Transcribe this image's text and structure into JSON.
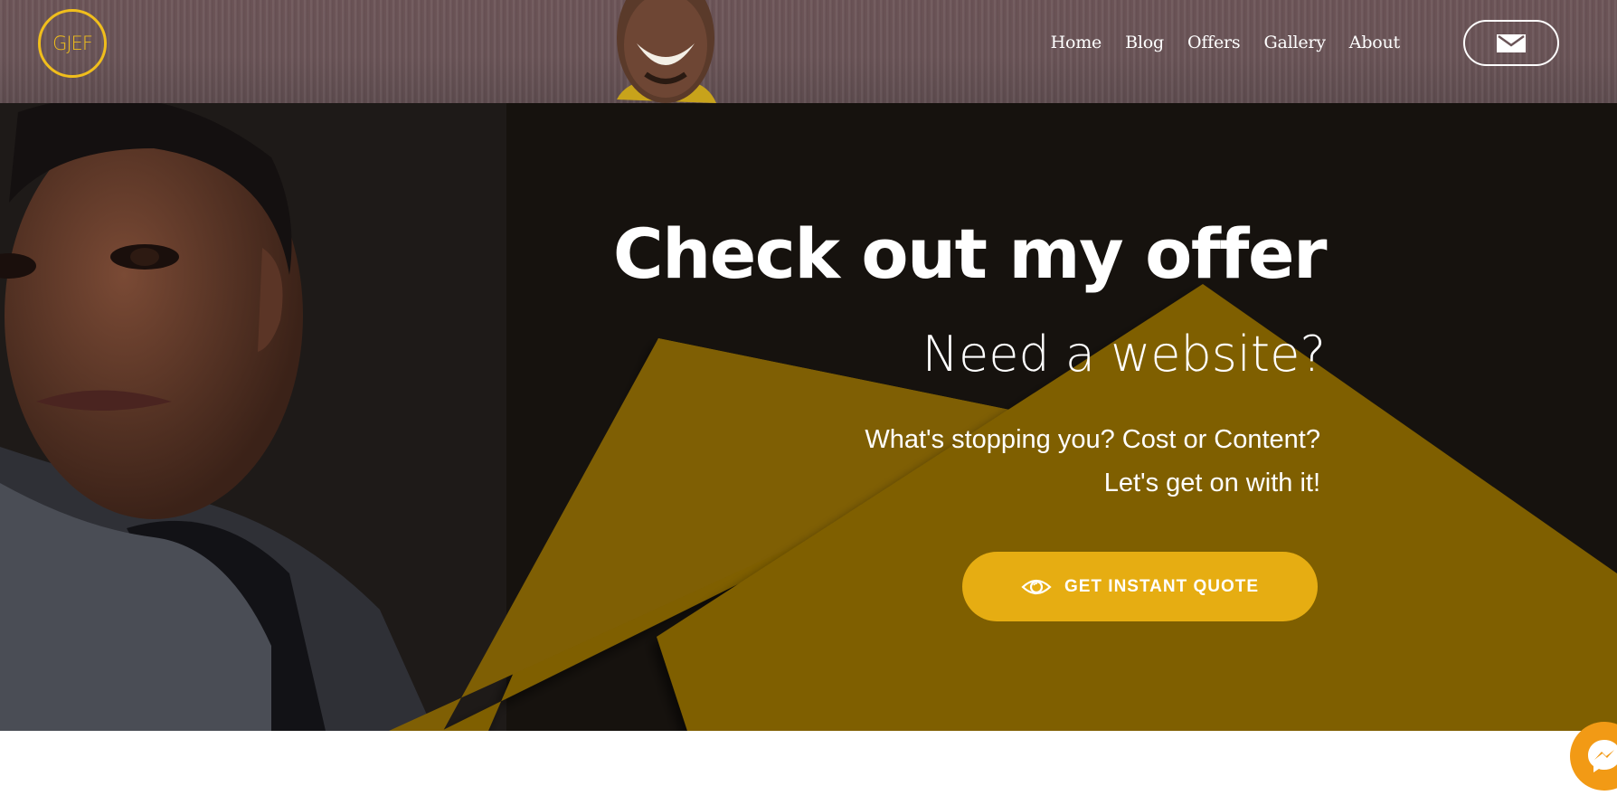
{
  "header": {
    "logo_text": "GJEF",
    "nav": [
      "Home",
      "Blog",
      "Offers",
      "Gallery",
      "About"
    ],
    "mail_icon": "envelope-icon"
  },
  "hero": {
    "title": "Check out my offer",
    "subtitle": "Need a website?",
    "line1": "What's stopping you? Cost or Content?",
    "line2": "Let's get on with it!",
    "cta_label": "GET INSTANT QUOTE",
    "cta_icon": "eye-icon"
  },
  "colors": {
    "accent": "#e6ad12",
    "logo": "#f0be1c",
    "polygon": "#7f5f04",
    "hero_bg": "#16120e",
    "messenger": "#f29a15"
  },
  "messenger": {
    "icon": "messenger-icon"
  }
}
